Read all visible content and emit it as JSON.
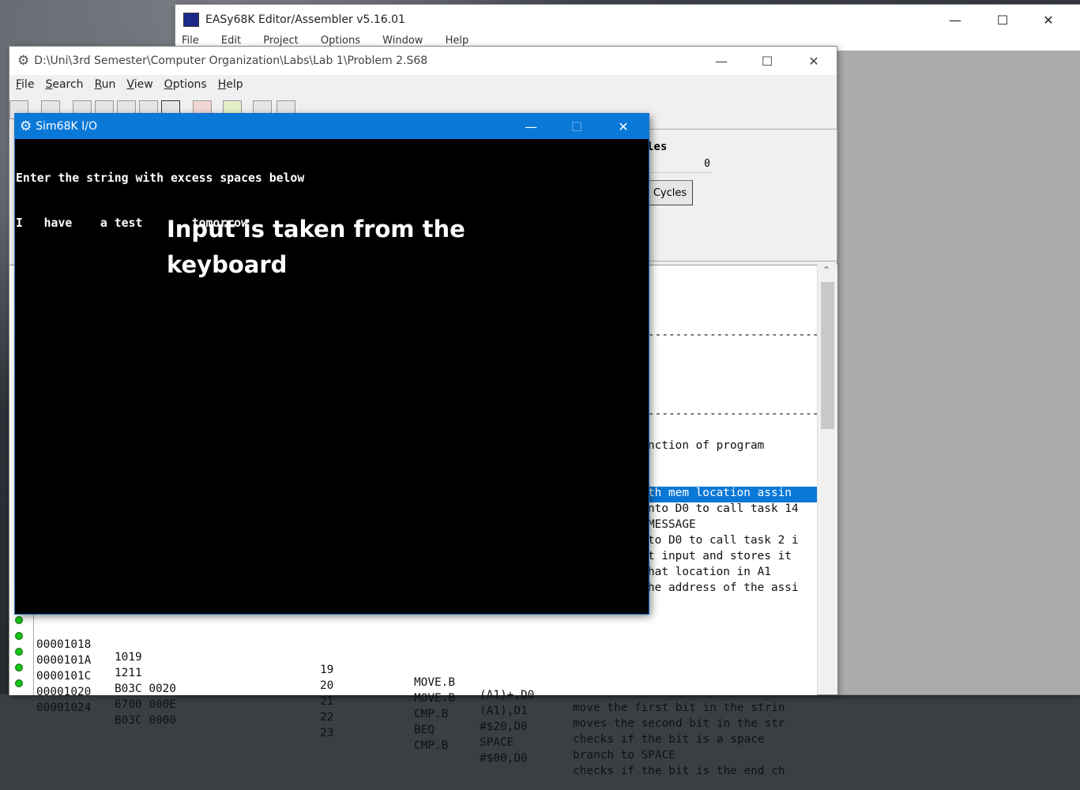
{
  "editor_window": {
    "title": "EASy68K Editor/Assembler v5.16.01",
    "menu": [
      "File",
      "Edit",
      "Project",
      "Options",
      "Window",
      "Help"
    ]
  },
  "sim_window": {
    "title": "D:\\Uni\\3rd Semester\\Computer Organization\\Labs\\Lab 1\\Problem 2.S68",
    "menu": [
      "File",
      "Search",
      "Run",
      "View",
      "Options",
      "Help"
    ],
    "cycles_label": "les",
    "cycles_value": "0",
    "clear_cycles_label": "Cycles",
    "listing_fragments": [
      "---------------------------",
      "---------------------------",
      "nction of program",
      "th mem location assin",
      "nto D0 to call task 14",
      "MESSAGE",
      "to D0 to call task 2 i",
      "t input and stores it",
      "hat location in A1",
      "he address of the assi"
    ],
    "listing_rows": [
      {
        "addr": "00001018",
        "code": "1019",
        "line": "19",
        "op": "MOVE.B",
        "operand": "(A1)+,D0",
        "comment": "move the first bit in the strin"
      },
      {
        "addr": "0000101A",
        "code": "1211",
        "line": "20",
        "op": "MOVE.B",
        "operand": "(A1),D1",
        "comment": "moves the second bit in the str"
      },
      {
        "addr": "0000101C",
        "code": "B03C 0020",
        "line": "21",
        "op": "CMP.B",
        "operand": "#$20,D0",
        "comment": "checks if the bit is a space"
      },
      {
        "addr": "00001020",
        "code": "6700 000E",
        "line": "22",
        "op": "BEQ",
        "operand": "SPACE",
        "comment": "branch to SPACE"
      },
      {
        "addr": "00001024",
        "code": "B03C 0000",
        "line": "23",
        "op": "CMP.B",
        "operand": "#$00,D0",
        "comment": "checks if the bit is the end ch"
      }
    ]
  },
  "io_window": {
    "title": "Sim68K I/O",
    "console_lines": [
      "Enter the string with excess spaces below",
      "I   have    a test       tomorrow"
    ],
    "annotation_line1": "Input is taken from the",
    "annotation_line2": "keyboard"
  },
  "colors": {
    "io_titlebar": "#0a78d7",
    "highlight": "#0a78d7",
    "breakpoint_dot": "#17c21a"
  }
}
